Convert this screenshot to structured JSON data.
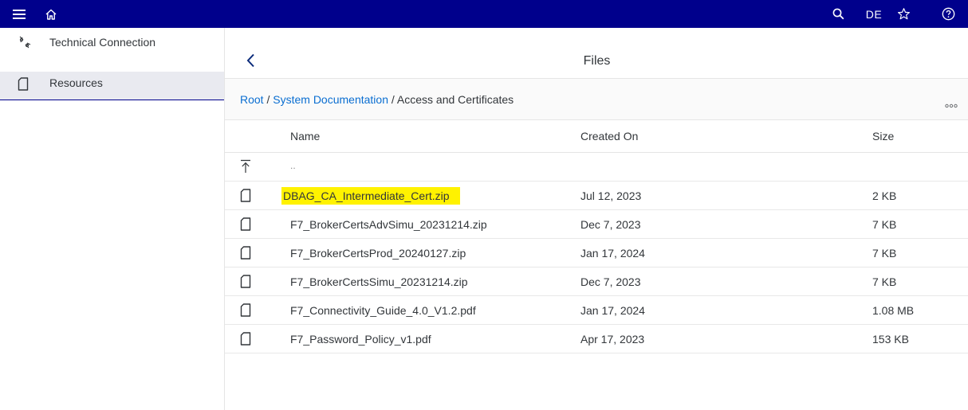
{
  "topbar": {
    "language": "DE",
    "icons": [
      "menu-icon",
      "home-icon",
      "search-icon",
      "star-icon",
      "help-icon"
    ],
    "background": "#00008c"
  },
  "sidebar": {
    "items": [
      {
        "label": "Technical Connection",
        "icon": "connection-icon",
        "active": false
      },
      {
        "label": "Resources",
        "icon": "document-icon",
        "active": true
      }
    ]
  },
  "page": {
    "title": "Files"
  },
  "breadcrumb": {
    "items": [
      "Root",
      "System Documentation",
      "Access and Certificates"
    ],
    "separator": " / "
  },
  "table": {
    "columns": [
      "Name",
      "Created On",
      "Size"
    ],
    "parent_row": "..",
    "rows": [
      {
        "name": "DBAG_CA_Intermediate_Cert.zip",
        "created": "Jul 12, 2023",
        "size": "2 KB",
        "highlighted": true
      },
      {
        "name": "F7_BrokerCertsAdvSimu_20231214.zip",
        "created": "Dec 7, 2023",
        "size": "7 KB"
      },
      {
        "name": "F7_BrokerCertsProd_20240127.zip",
        "created": "Jan 17, 2024",
        "size": "7 KB"
      },
      {
        "name": "F7_BrokerCertsSimu_20231214.zip",
        "created": "Dec 7, 2023",
        "size": "7 KB"
      },
      {
        "name": "F7_Connectivity_Guide_4.0_V1.2.pdf",
        "created": "Jan 17, 2024",
        "size": "1.08 MB"
      },
      {
        "name": "F7_Password_Policy_v1.pdf",
        "created": "Apr 17, 2023",
        "size": "153 KB"
      }
    ]
  },
  "colors": {
    "link": "#0a6ed1",
    "highlight": "#fff200",
    "active_item_bg": "#e9eaf0"
  }
}
